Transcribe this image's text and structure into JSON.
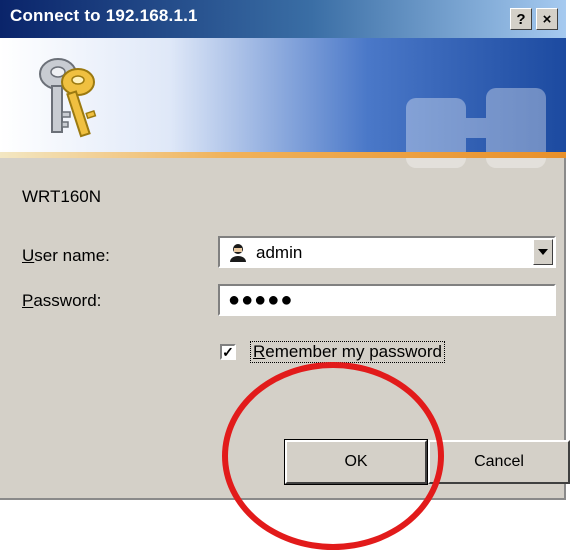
{
  "window": {
    "title": "Connect to 192.168.1.1",
    "help_label": "?",
    "close_label": "×"
  },
  "device_name": "WRT160N",
  "form": {
    "user_label_u": "U",
    "user_label_rest": "ser name:",
    "user_value": "admin",
    "pass_label_u": "P",
    "pass_label_rest": "assword:",
    "pass_value": "●●●●●",
    "remember_checked": true,
    "remember_check_glyph": "✓",
    "remember_u": "R",
    "remember_rest": "emember my password"
  },
  "buttons": {
    "ok_label": "OK",
    "cancel_label": "Cancel"
  },
  "colors": {
    "title_gradient_start": "#0a246a",
    "highlight_circle": "#e21b1b"
  },
  "icons": [
    "keys-icon",
    "user-icon",
    "dropdown-arrow-icon"
  ]
}
